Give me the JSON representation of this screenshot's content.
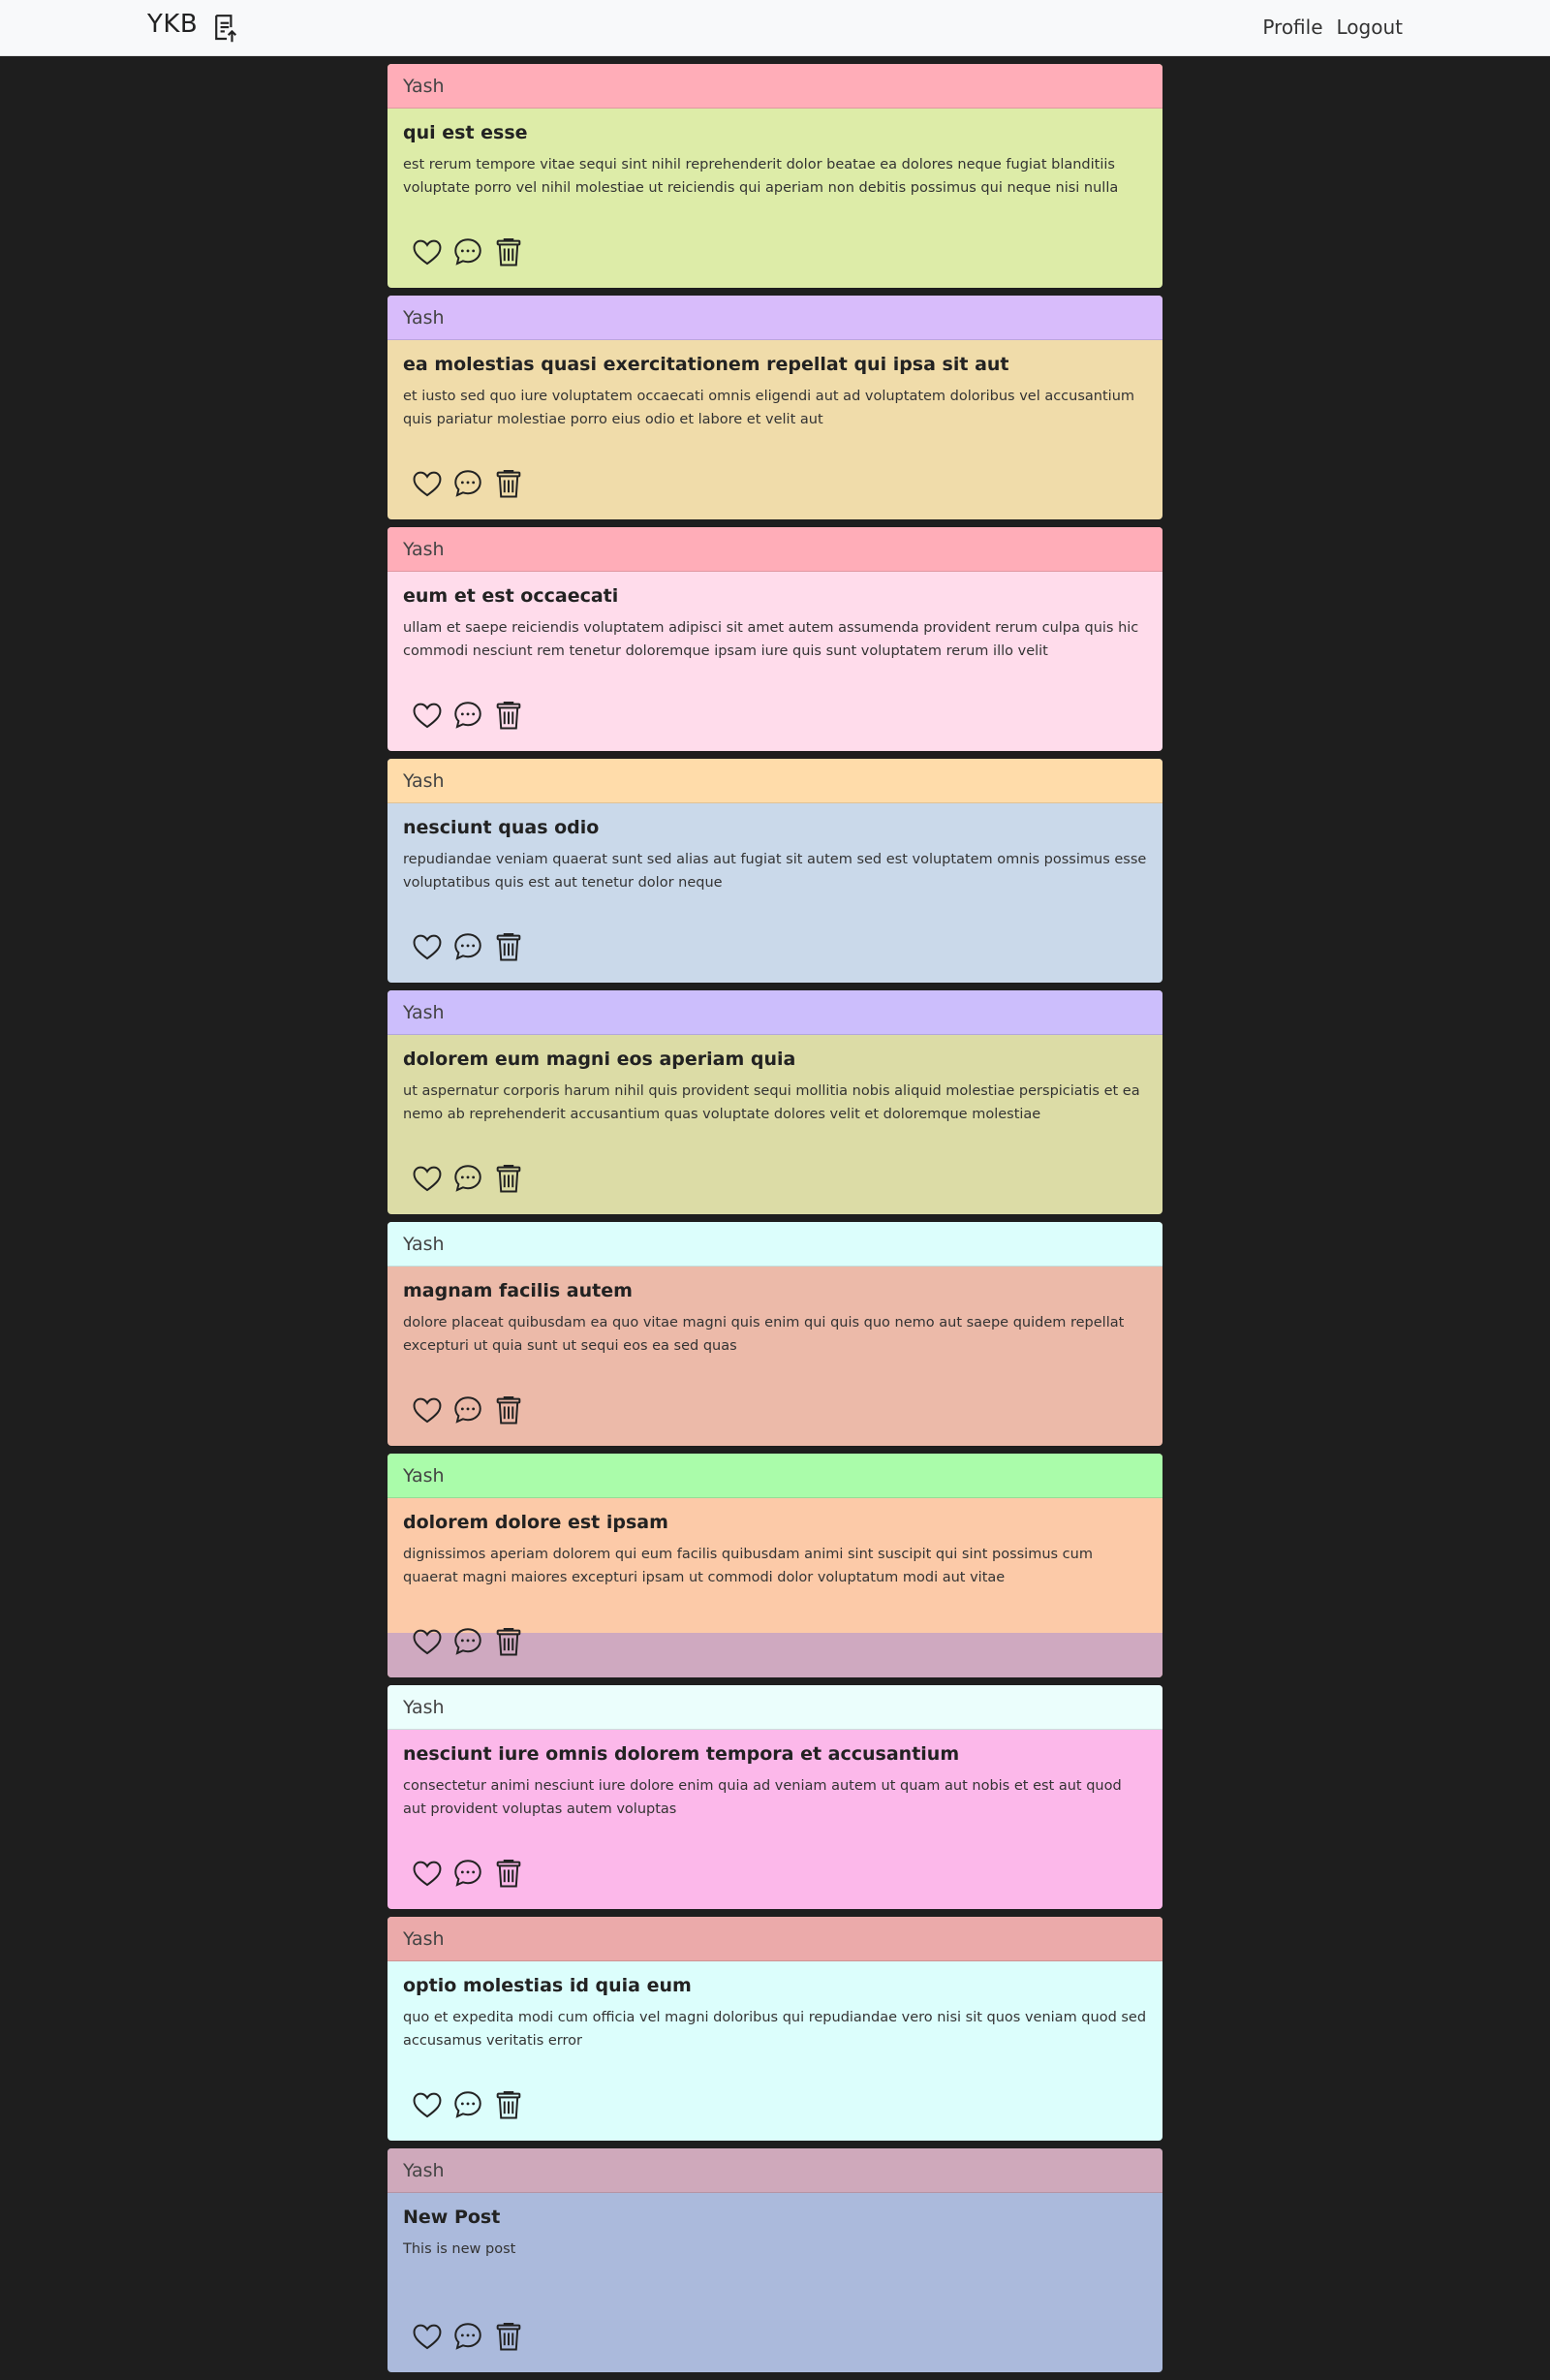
{
  "nav": {
    "brand": "YKB",
    "brand_icon": "post-upload-icon",
    "links": [
      "Profile",
      "Logout"
    ]
  },
  "posts": [
    {
      "author": "Yash",
      "title": "qui est esse",
      "body": "est rerum tempore vitae sequi sint nihil reprehenderit dolor beatae ea dolores neque fugiat blanditiis voluptate porro vel nihil molestiae ut reiciendis qui aperiam non debitis possimus qui neque nisi nulla",
      "header_color": "#ffadb8",
      "body_color": "#ddeca8"
    },
    {
      "author": "Yash",
      "title": "ea molestias quasi exercitationem repellat qui ipsa sit aut",
      "body": "et iusto sed quo iure voluptatem occaecati omnis eligendi aut ad voluptatem doloribus vel accusantium quis pariatur molestiae porro eius odio et labore et velit aut",
      "header_color": "#d8bcfb",
      "body_color": "#f0dcaa"
    },
    {
      "author": "Yash",
      "title": "eum et est occaecati",
      "body": "ullam et saepe reiciendis voluptatem adipisci sit amet autem assumenda provident rerum culpa quis hic commodi nesciunt rem tenetur doloremque ipsam iure quis sunt voluptatem rerum illo velit",
      "header_color": "#ffadb8",
      "body_color": "#ffdceb"
    },
    {
      "author": "Yash",
      "title": "nesciunt quas odio",
      "body": "repudiandae veniam quaerat sunt sed alias aut fugiat sit autem sed est voluptatem omnis possimus esse voluptatibus quis est aut tenetur dolor neque",
      "header_color": "#ffdcaa",
      "body_color": "#cad9ea"
    },
    {
      "author": "Yash",
      "title": "dolorem eum magni eos aperiam quia",
      "body": "ut aspernatur corporis harum nihil quis provident sequi mollitia nobis aliquid molestiae perspiciatis et ea nemo ab reprehenderit accusantium quas voluptate dolores velit et doloremque molestiae",
      "header_color": "#ccbefc",
      "body_color": "#dcdca6"
    },
    {
      "author": "Yash",
      "title": "magnam facilis autem",
      "body": "dolore placeat quibusdam ea quo vitae magni quis enim qui quis quo nemo aut saepe quidem repellat excepturi ut quia sunt ut sequi eos ea sed quas",
      "header_color": "#dcfefc",
      "body_color": "#ecbaa9"
    },
    {
      "author": "Yash",
      "title": "dolorem dolore est ipsam",
      "body": "dignissimos aperiam dolorem qui eum facilis quibusdam animi sint suscipit qui sint possimus cum quaerat magni maiores excepturi ipsam ut commodi dolor voluptatum modi aut vitae",
      "header_color": "#aafcaa",
      "body_color": "#fccaa8",
      "footer_band": true
    },
    {
      "author": "Yash",
      "title": "nesciunt iure omnis dolorem tempora et accusantium",
      "body": "consectetur animi nesciunt iure dolore enim quia ad veniam autem ut quam aut nobis et est aut quod aut provident voluptas autem voluptas",
      "header_color": "#ebfefc",
      "body_color": "#fcb8ea"
    },
    {
      "author": "Yash",
      "title": "optio molestias id quia eum",
      "body": "quo et expedita modi cum officia vel magni doloribus qui repudiandae vero nisi sit quos veniam quod sed accusamus veritatis error",
      "header_color": "#ebaaaa",
      "body_color": "#dcfefc"
    },
    {
      "author": "Yash",
      "title": "New Post",
      "body": "This is new post",
      "header_color": "#cfa9bb",
      "body_color": "#abbadc"
    }
  ],
  "action_icons": [
    "heart-icon",
    "comment-icon",
    "trash-icon"
  ]
}
